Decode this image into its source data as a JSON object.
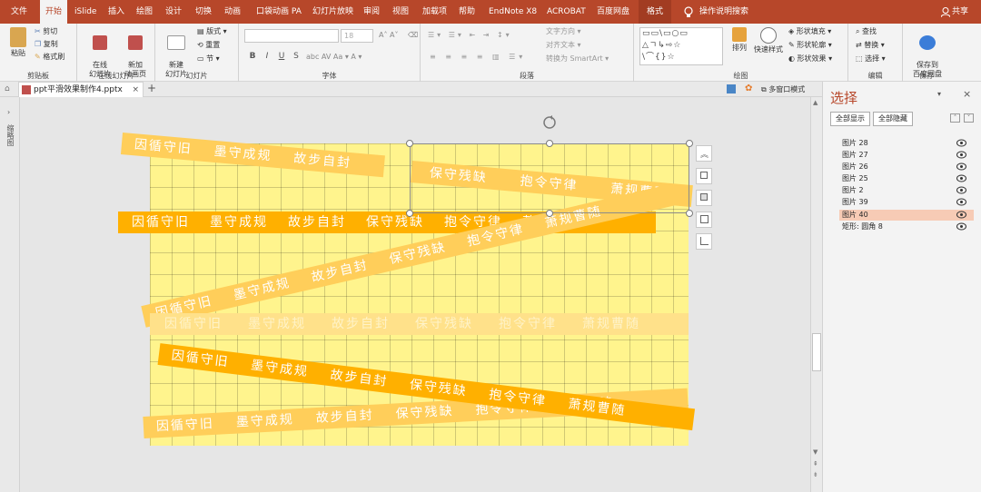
{
  "menu": {
    "tabs": [
      "文件",
      "开始",
      "iSlide",
      "插入",
      "绘图",
      "设计",
      "切换",
      "动画",
      "口袋动画 PA",
      "幻灯片放映",
      "审阅",
      "视图",
      "加载项",
      "帮助",
      "EndNote X8",
      "ACROBAT",
      "百度网盘",
      "格式"
    ],
    "search": "操作说明搜索",
    "share": "共享"
  },
  "ribbon": {
    "clipboard": {
      "paste": "粘贴",
      "cut": "剪切",
      "copy": "复制",
      "painter": "格式刷",
      "label": "剪贴板"
    },
    "online": {
      "b1": "在线\n幻灯片",
      "b2": "新加\n动画页",
      "label": "在线幻灯片"
    },
    "slides": {
      "new": "新建\n幻灯片",
      "layout": "版式",
      "reset": "重置",
      "section": "节",
      "label": "幻灯片"
    },
    "font": {
      "label": "字体",
      "size": "18",
      "bold": "B",
      "italic": "I",
      "underline": "U",
      "strike": "S"
    },
    "para": {
      "label": "段落",
      "dir": "文字方向",
      "align": "对齐文本",
      "smartart": "转换为 SmartArt"
    },
    "drawing": {
      "label": "绘图",
      "arrange": "排列",
      "quick": "快速样式",
      "fill": "形状填充",
      "outline": "形状轮廓",
      "effect": "形状效果"
    },
    "edit": {
      "label": "编辑",
      "find": "查找",
      "replace": "替换",
      "select": "选择"
    },
    "save": {
      "label": "保存",
      "btn": "保存到\n百度网盘"
    }
  },
  "doc": {
    "tab": "ppt平滑效果制作4.pptx",
    "rail": "缩略图",
    "window": "多窗口模式"
  },
  "slide": {
    "phrases": [
      "因循守旧",
      "墨守成规",
      "故步自封",
      "保守残缺",
      "抱令守律",
      "萧规曹随"
    ],
    "short": [
      "因循守旧",
      "墨守成规",
      "故步自封"
    ]
  },
  "panel": {
    "title": "选择",
    "showall": "全部显示",
    "hideall": "全部隐藏",
    "items": [
      "图片 28",
      "图片 27",
      "图片 26",
      "图片 25",
      "图片 2",
      "图片 39",
      "图片 40",
      "矩形: 圆角 8"
    ],
    "selected": "图片 40"
  },
  "colors": {
    "accent": "#b7472a",
    "slide": "#fff48d",
    "band_strong": "#ffb000",
    "band_soft": "#ffce5a"
  }
}
